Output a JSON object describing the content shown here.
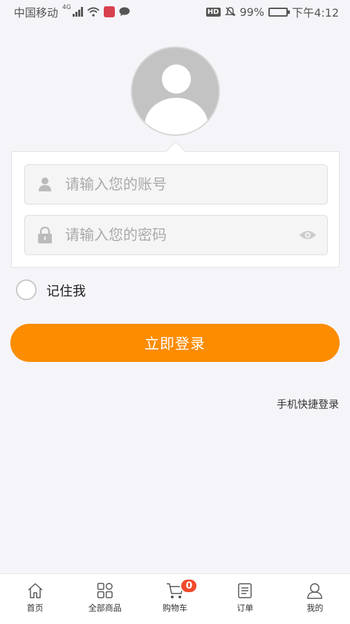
{
  "status_bar": {
    "carrier": "中国移动",
    "network": "4G",
    "battery": "99%",
    "battery_level": 0.99,
    "time": "下午4:12",
    "hd_label": "HD"
  },
  "login": {
    "account_placeholder": "请输入您的账号",
    "password_placeholder": "请输入您的密码",
    "remember_label": "记住我",
    "login_button": "立即登录",
    "quick_login": "手机快捷登录"
  },
  "tabbar": {
    "items": [
      {
        "label": "首页",
        "icon": "home-icon"
      },
      {
        "label": "全部商品",
        "icon": "grid-icon"
      },
      {
        "label": "购物车",
        "icon": "cart-icon",
        "badge": "0"
      },
      {
        "label": "订单",
        "icon": "order-icon"
      },
      {
        "label": "我的",
        "icon": "user-icon"
      }
    ]
  },
  "colors": {
    "accent": "#fc8c00",
    "badge": "#f04a2c",
    "background": "#f5f5f9"
  }
}
